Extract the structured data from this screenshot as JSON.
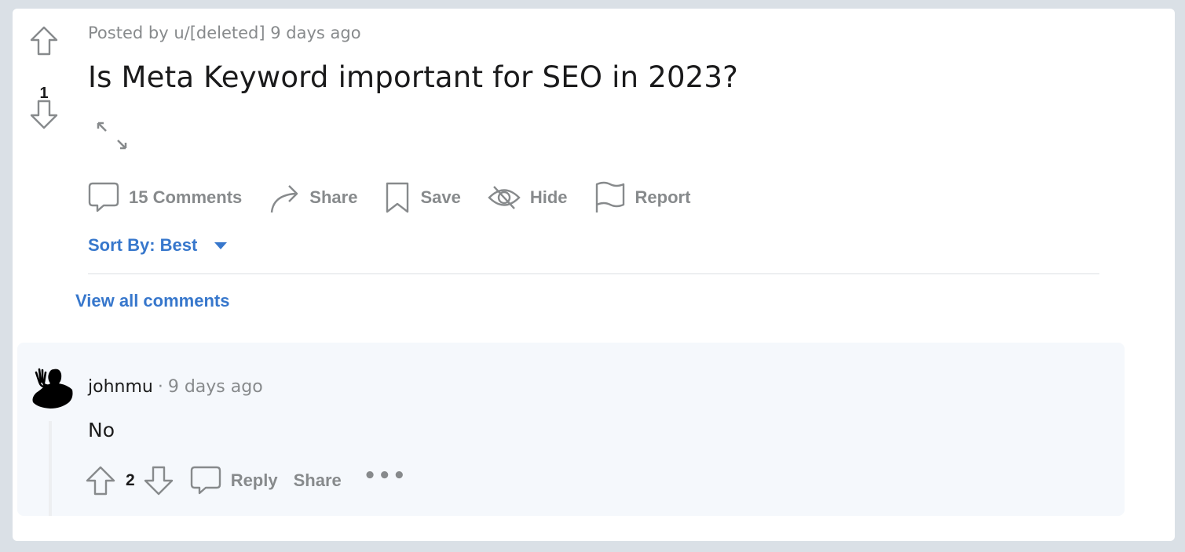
{
  "post": {
    "score": "1",
    "posted_by_prefix": "Posted by",
    "author": "u/[deleted]",
    "time": "9 days ago",
    "title": "Is Meta Keyword important for SEO in 2023?",
    "actions": {
      "comments": "15 Comments",
      "share": "Share",
      "save": "Save",
      "hide": "Hide",
      "report": "Report"
    },
    "icons": [
      "arrow-up-icon",
      "arrow-down-icon",
      "expand-icon",
      "comment-icon",
      "share-arrow-icon",
      "bookmark-icon",
      "eye-slash-icon",
      "flag-icon"
    ]
  },
  "sort": {
    "label": "Sort By: Best"
  },
  "view_all_comments": "View all comments",
  "comment": {
    "author": "johnmu",
    "separator": "·",
    "time": "9 days ago",
    "body": "No",
    "score": "2",
    "reply": "Reply",
    "share": "Share",
    "more": "•••"
  },
  "colors": {
    "background": "#dae0e6",
    "card": "#ffffff",
    "accent_blue": "#3777cc",
    "muted_gray": "#878a8c",
    "comment_bg": "#f5f8fc"
  }
}
